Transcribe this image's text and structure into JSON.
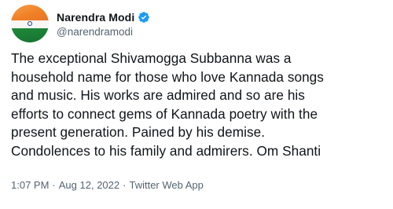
{
  "tweet": {
    "author": {
      "display_name": "Narendra Modi",
      "handle": "@narendramodi",
      "verified": true,
      "avatar_icon": "india-flag-avatar"
    },
    "text": "The exceptional Shivamogga Subbanna was a\nhousehold name for those who love Kannada songs\nand music. His works are admired and so are his\nefforts to connect gems of Kannada poetry with the\npresent generation. Pained by his demise.\nCondolences to his family and admirers. Om Shanti",
    "meta": {
      "time": "1:07 PM",
      "separator": "·",
      "date": "Aug 12, 2022",
      "source": "Twitter Web App"
    },
    "colors": {
      "text": "#0f1419",
      "secondary": "#536471",
      "verified_badge": "#1d9bf0"
    }
  }
}
